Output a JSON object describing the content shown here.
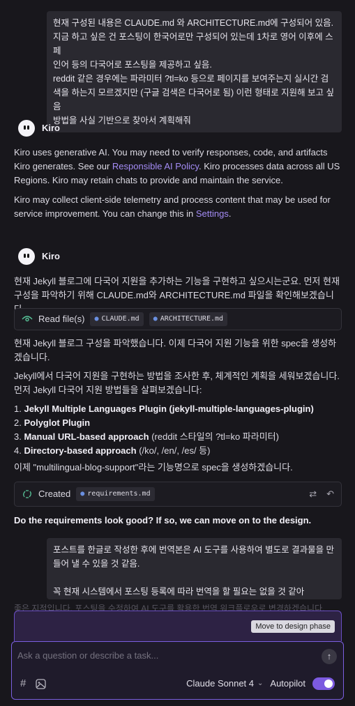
{
  "messages": {
    "user1": {
      "lines": [
        "현재 구성된 내용은 CLAUDE.md 와 ARCHITECTURE.md에 구성되어 있음.",
        "지금 하고 싶은 건 포스팅이 한국어로만 구성되어 있는데 1차로 영어 이후에 스페",
        "인어 등의 다국어로 포스팅을 제공하고 싶음.",
        "reddit 같은 경우에는 파라미터 ?tl=ko 등으로 페이지를 보여주는지 실시간 검",
        "색을 하는지 모르겠지만 (구글 검색은 다국어로 됨) 이런 형태로 지원해 보고 싶",
        "음",
        "방법을 사실 기반으로 찾아서 계획해줘"
      ]
    },
    "kiro_name": "Kiro",
    "notice": {
      "p1_before": "Kiro uses generative AI. You may need to verify responses, code, and artifacts Kiro generates. See our ",
      "p1_link": "Responsible AI Policy",
      "p1_after": ". Kiro processes data across all US Regions. Kiro may retain chats to provide and maintain the service.",
      "p2_before": "Kiro may collect client-side telemetry and process content that may be used for service improvement. You can change this in ",
      "p2_link": "Settings",
      "p2_after": "."
    },
    "kiro2": {
      "intro": "현재 Jekyll 블로그에 다국어 지원을 추가하는 기능을 구현하고 싶으시는군요. 먼저 현재 구성을 파악하기 위해 CLAUDE.md와 ARCHITECTURE.md 파일을 확인해보겠습니다.",
      "read_label": "Read file(s)",
      "read_files": [
        "CLAUDE.md",
        "ARCHITECTURE.md"
      ],
      "p2": "현재 Jekyll 블로그 구성을 파악했습니다. 이제 다국어 지원 기능을 위한 spec을 생성하겠습니다.",
      "p3": "Jekyll에서 다국어 지원을 구현하는 방법을 조사한 후, 체계적인 계획을 세워보겠습니다. 먼저 Jekyll 다국어 지원 방법들을 살펴보겠습니다:",
      "plan": [
        {
          "num": "1.",
          "bold": "Jekyll Multiple Languages Plugin (jekyll-multiple-languages-plugin)",
          "rest": ""
        },
        {
          "num": "2.",
          "bold": "Polyglot Plugin",
          "rest": ""
        },
        {
          "num": "3.",
          "bold": "Manual URL-based approach",
          "rest": " (reddit 스타일의 ?tl=ko 파라미터)"
        },
        {
          "num": "4.",
          "bold": "Directory-based approach",
          "rest": " (/ko/, /en/, /es/ 등)"
        }
      ],
      "p4": "이제 \"multilingual-blog-support\"라는 기능명으로 spec을 생성하겠습니다.",
      "created_label": "Created",
      "created_file": "requirements.md",
      "question": "Do the requirements look good? If so, we can move on to the design."
    },
    "user2": {
      "text": "포스트를 한글로 작성한 후에 번역본은 AI 도구를 사용하여 별도로 결과물을 만\n들어 낼 수 있을 것 같음.\n\n꼭 현재 시스템에서 포스팅 등록에 따라 번역을 할 필요는 없을 것 같아"
    },
    "ghost": "좋은 지적입니다. 포스팅을 수정하여 AI 도구를 활용한 번역 워크플로우로 변경하겠습니다."
  },
  "action": {
    "move_label": "Move to design phase"
  },
  "composer": {
    "placeholder": "Ask a question or describe a task...",
    "model": "Claude Sonnet 4",
    "autopilot_label": "Autopilot",
    "autopilot_on": true
  },
  "colors": {
    "accent": "#7c5ae0",
    "link": "#a48cf5"
  }
}
